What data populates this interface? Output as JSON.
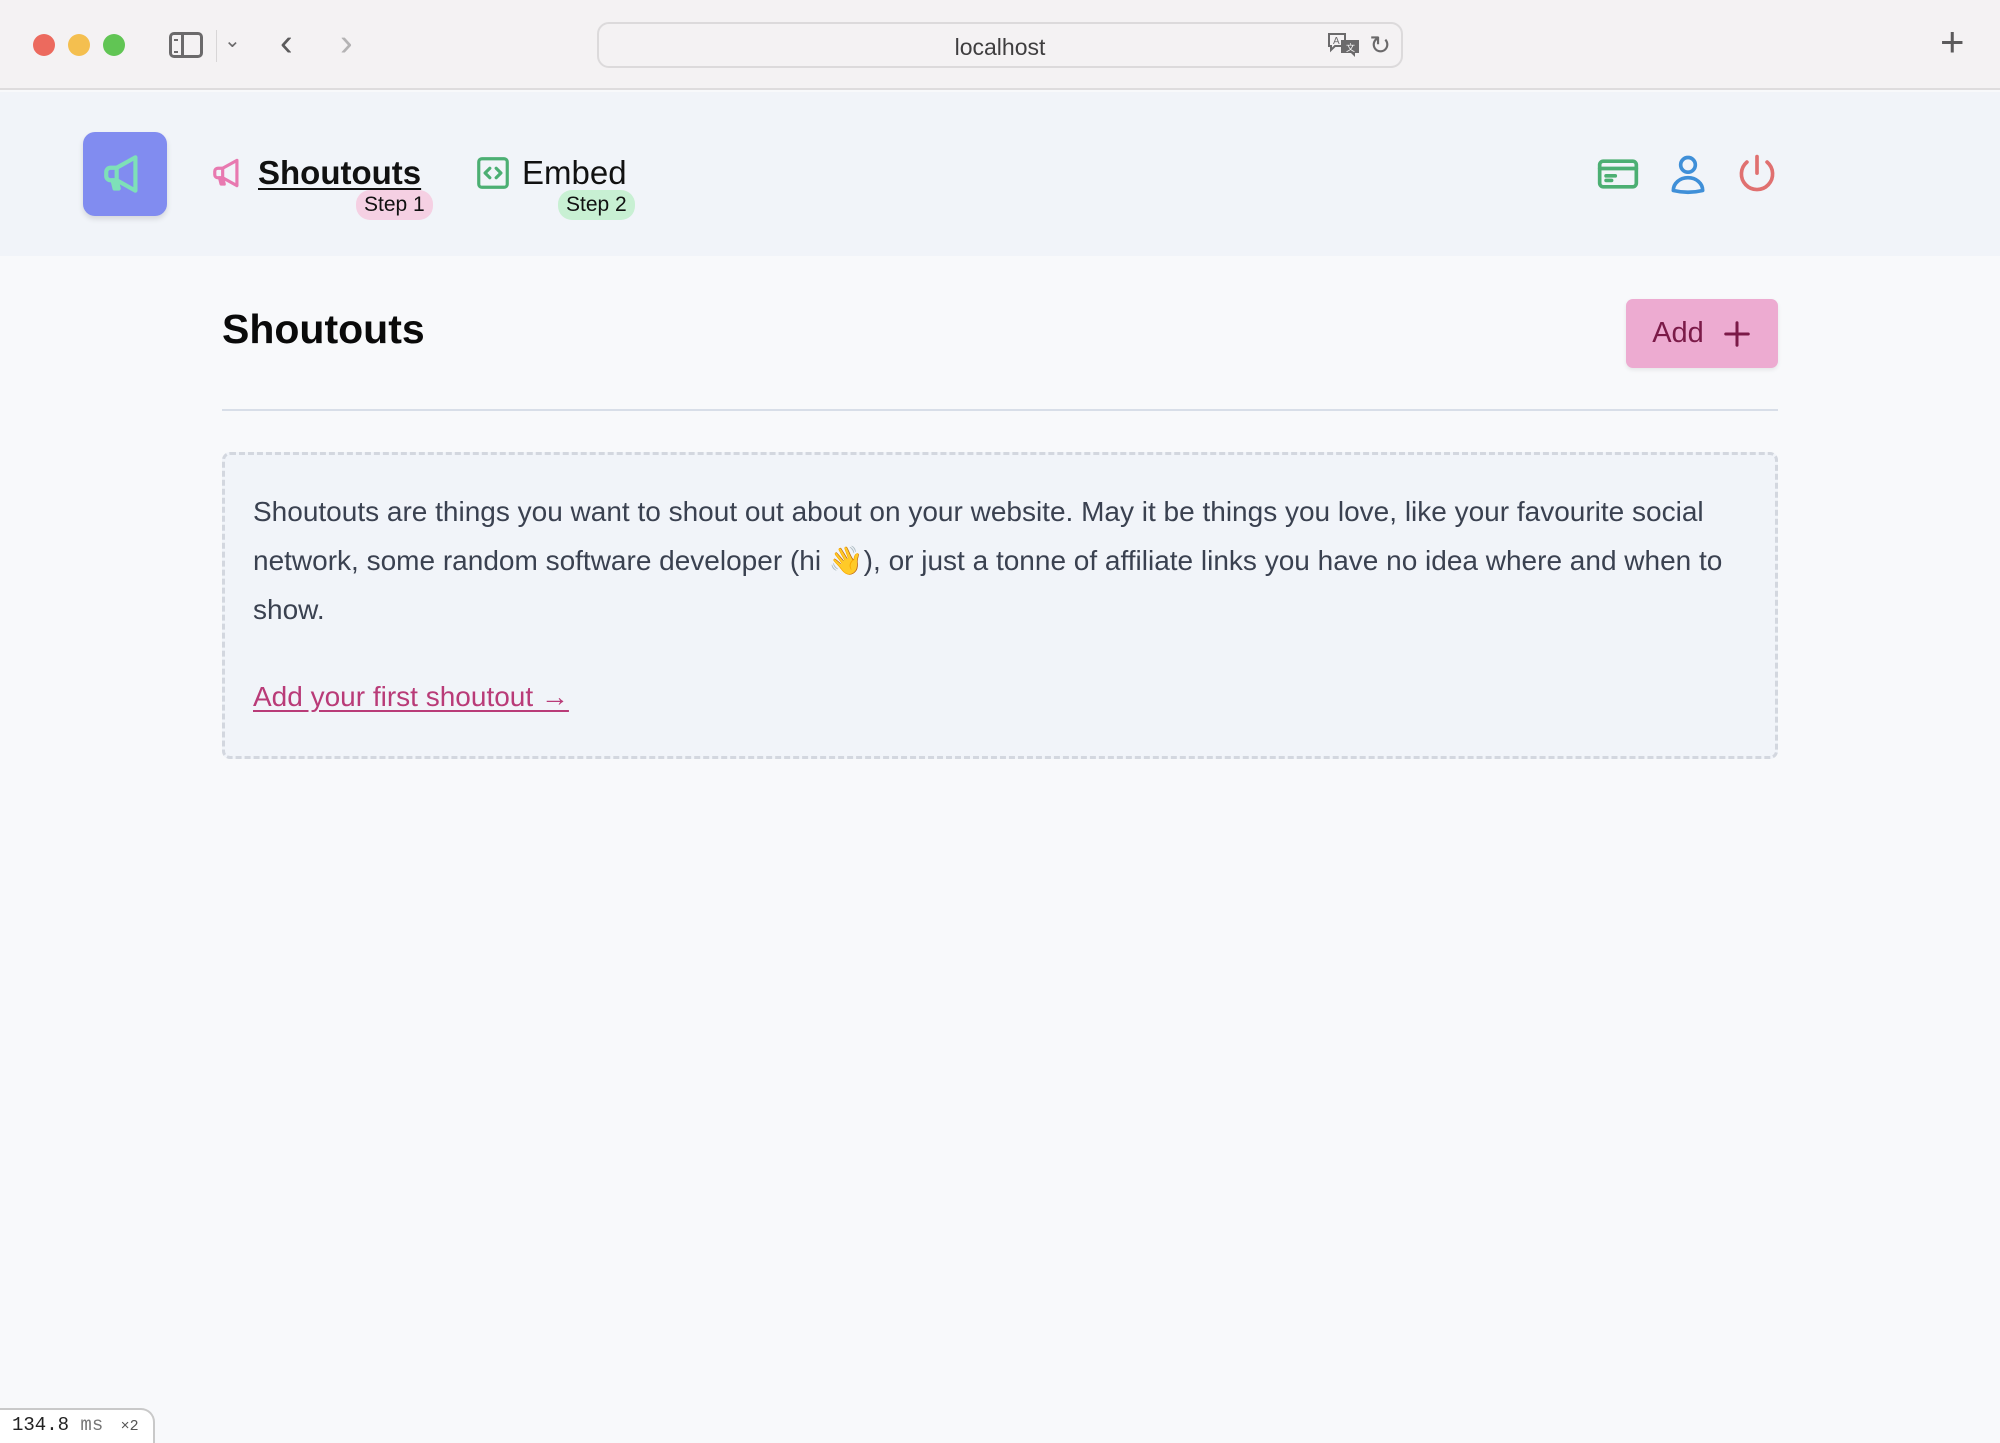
{
  "browser": {
    "url": "localhost",
    "icons": {
      "sidebar": "sidebar-toggle-icon",
      "back": "chevron-left-icon",
      "forward": "chevron-right-icon",
      "translate": "translate-icon",
      "reload": "reload-icon",
      "new_tab": "plus-icon"
    },
    "glyphs": {
      "chevron_down": "⌄",
      "back": "‹",
      "forward": "›",
      "reload": "↻",
      "new_tab": "+"
    }
  },
  "header": {
    "logo_icon": "megaphone-icon",
    "nav": [
      {
        "label": "Shoutouts",
        "step": "Step 1",
        "icon": "megaphone-icon",
        "active": true
      },
      {
        "label": "Embed",
        "step": "Step 2",
        "icon": "code-icon",
        "active": false
      }
    ],
    "actions": [
      {
        "name": "billing",
        "icon": "credit-card-icon",
        "color": "#4caf73"
      },
      {
        "name": "account",
        "icon": "user-icon",
        "color": "#3f8fd8"
      },
      {
        "name": "logout",
        "icon": "power-icon",
        "color": "#e07070"
      }
    ]
  },
  "main": {
    "title": "Shoutouts",
    "add_button_label": "Add",
    "empty_state": {
      "text": "Shoutouts are things you want to shout out about on your website. May it be things you love, like your favourite social network, some random software developer (hi 👋), or just a tonne of affiliate links you have no idea where and when to show.",
      "link_label": "Add your first shoutout →"
    }
  },
  "colors": {
    "logo_bg": "#818cf0",
    "logo_icon": "#7ee0b8",
    "accent_pink": "#e879b0",
    "add_button_bg": "#edabd1",
    "add_button_text": "#7b1a48",
    "link": "#b93b78",
    "step1_bg": "#f5d0e3",
    "step2_bg": "#c8f0d3",
    "embed_icon": "#4caf73"
  },
  "perf_badge": {
    "value": "134.8",
    "unit": "ms",
    "multiplier": "×2"
  }
}
